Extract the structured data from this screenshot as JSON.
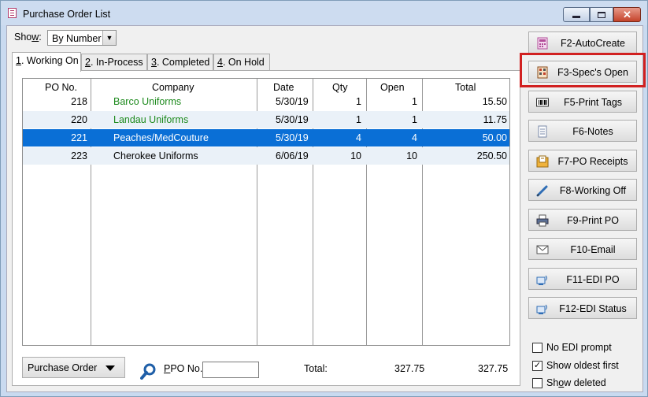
{
  "window": {
    "title": "Purchase Order List"
  },
  "show": {
    "label": "Show:",
    "selected": "By Number"
  },
  "tabs": [
    {
      "key": "1",
      "label": ". Working On"
    },
    {
      "key": "2",
      "label": ". In-Process"
    },
    {
      "key": "3",
      "label": ". Completed"
    },
    {
      "key": "4",
      "label": ". On Hold"
    }
  ],
  "grid": {
    "columns": [
      "PO No.",
      "Company",
      "Date",
      "Qty",
      "Open",
      "Total"
    ],
    "rows": [
      {
        "po": "218",
        "company": "Barco Uniforms",
        "date": "5/30/19",
        "qty": "1",
        "open": "1",
        "total": "15.50"
      },
      {
        "po": "220",
        "company": "Landau Uniforms",
        "date": "5/30/19",
        "qty": "1",
        "open": "1",
        "total": "11.75"
      },
      {
        "po": "221",
        "company": "Peaches/MedCouture",
        "date": "5/30/19",
        "qty": "4",
        "open": "4",
        "total": "50.00"
      },
      {
        "po": "223",
        "company": "Cherokee Uniforms",
        "date": "6/06/19",
        "qty": "10",
        "open": "10",
        "total": "250.50"
      }
    ]
  },
  "footer": {
    "type_button": "Purchase Order",
    "search_label": "PO No.",
    "search_value": "",
    "total_label": "Total:",
    "total_open": "327.75",
    "total_amount": "327.75"
  },
  "buttons": [
    {
      "label": "F2-AutoCreate",
      "icon": "calculator-icon"
    },
    {
      "label": "F3-Spec's Open",
      "icon": "spec-sheet-icon"
    },
    {
      "label": "F5-Print Tags",
      "icon": "barcode-icon"
    },
    {
      "label": "F6-Notes",
      "icon": "notes-icon"
    },
    {
      "label": "F7-PO Receipts",
      "icon": "receipts-icon"
    },
    {
      "label": "F8-Working Off",
      "icon": "pencil-icon"
    },
    {
      "label": "F9-Print PO",
      "icon": "printer-icon"
    },
    {
      "label": "F10-Email",
      "icon": "envelope-icon"
    },
    {
      "label": "F11-EDI PO",
      "icon": "edi-icon"
    },
    {
      "label": "F12-EDI Status",
      "icon": "edi-status-icon"
    }
  ],
  "checkboxes": [
    {
      "label": "No EDI prompt",
      "checked": false
    },
    {
      "label": "Show oldest first",
      "checked": true
    },
    {
      "label": "Show deleted",
      "checked": false
    }
  ],
  "colors": {
    "selection": "#0a6fd6",
    "company_text": "#1d8a1d",
    "highlight": "#d12020"
  }
}
